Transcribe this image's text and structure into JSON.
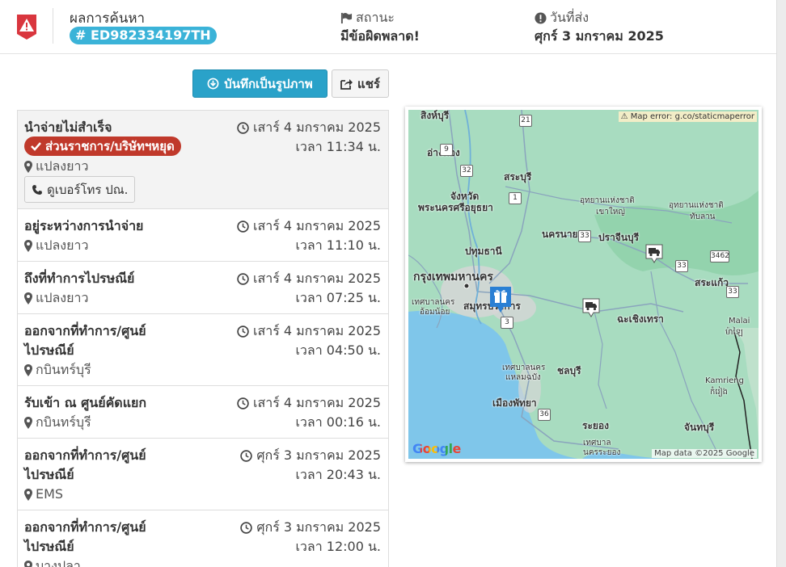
{
  "header": {
    "title": "ผลการค้นหา",
    "tracking_number": "# ED982334197TH",
    "status_label": "สถานะ",
    "status_value": "มีข้อผิดพลาด!",
    "date_label": "วันที่ส่ง",
    "date_value": "ศุกร์ 3 มกราคม 2025"
  },
  "actions": {
    "save_image_label": "บันทึกเป็นรูปภาพ",
    "share_label": "แชร์"
  },
  "events": [
    {
      "title": "นำจ่ายไม่สำเร็จ",
      "badge": "ส่วนราชการ/บริษัทฯหยุด",
      "location": "แปลงยาว",
      "date": "เสาร์ 4 มกราคม 2025",
      "time": "เวลา 11:34 น.",
      "phone_button": "ดูเบอร์โทร ปณ."
    },
    {
      "title": "อยู่ระหว่างการนำจ่าย",
      "location": "แปลงยาว",
      "date": "เสาร์ 4 มกราคม 2025",
      "time": "เวลา 11:10 น."
    },
    {
      "title": "ถึงที่ทำการไปรษณีย์",
      "location": "แปลงยาว",
      "date": "เสาร์ 4 มกราคม 2025",
      "time": "เวลา 07:25 น."
    },
    {
      "title_line1": "ออกจากที่ทำการ/ศูนย์",
      "title_line2": "ไปรษณีย์",
      "location": "กบินทร์บุรี",
      "date": "เสาร์ 4 มกราคม 2025",
      "time": "เวลา 04:50 น."
    },
    {
      "title": "รับเข้า ณ ศูนย์คัดแยก",
      "location": "กบินทร์บุรี",
      "date": "เสาร์ 4 มกราคม 2025",
      "time": "เวลา 00:16 น."
    },
    {
      "title_line1": "ออกจากที่ทำการ/ศูนย์",
      "title_line2": "ไปรษณีย์",
      "location": "EMS",
      "date": "ศุกร์ 3 มกราคม 2025",
      "time": "เวลา 20:43 น."
    },
    {
      "title_line1": "ออกจากที่ทำการ/ศูนย์",
      "title_line2": "ไปรษณีย์",
      "location": "บางปลา",
      "date": "ศุกร์ 3 มกราคม 2025",
      "time": "เวลา 12:00 น."
    }
  ],
  "map": {
    "error_text": "Map error: g.co/staticmaperror",
    "attribution": "Map data ©2025 Google",
    "google_logo": "Google",
    "labels": {
      "singburi": "สิงห์บุรี",
      "angthong": "อ่างทอง",
      "saraburi": "สระบุรี",
      "ayutthaya_1": "จังหวัด",
      "ayutthaya_2": "พระนครศรีอยุธยา",
      "khaoyai_1": "อุทยานแห่งชาติ",
      "khaoyai_2": "เขาใหญ่",
      "tablan_1": "อุทยานแห่งชาติ",
      "tablan_2": "ทับลาน",
      "nakhonnayok": "นครนายก",
      "prachinburi": "ปราจีนบุรี",
      "pathumthani": "ปทุมธานี",
      "bangkok": "กรุงเทพมหานคร",
      "samutprakan": "สมุทรปราการ",
      "omnoi_1": "เทศบาลนคร",
      "omnoi_2": "อ้อมน้อย",
      "chachoengsao": "ฉะเชิงเทรา",
      "sakaeo": "สระแก้ว",
      "laemchabang_1": "เทศบาลนคร",
      "laemchabang_2": "แหลมฉบัง",
      "chonburi": "ชลบุรี",
      "pattaya": "เมืองพัทยา",
      "rayong": "ระยอง",
      "nakhonrayong_1": "เทศบาล",
      "nakhonrayong_2": "นครระยอง",
      "chanthaburi": "จันทบุรี",
      "malai_1": "Malai",
      "malai_2": "ម៉ាឡៃ",
      "kamrieng_1": "Kamrieng",
      "kamrieng_2": "កំរៀង"
    },
    "road_numbers": [
      "21",
      "9",
      "32",
      "1",
      "33",
      "33",
      "3462",
      "33",
      "3",
      "36"
    ],
    "colors": {
      "land": "#a8dcc0",
      "sea": "#7fc6ea",
      "city": "#d6d6d6",
      "marker": "#2a7fd4"
    }
  },
  "colors": {
    "primary": "#2aa2c9",
    "badge_blue": "#3bb3d8",
    "error_red": "#c0392b",
    "logo_red": "#d9363e"
  }
}
